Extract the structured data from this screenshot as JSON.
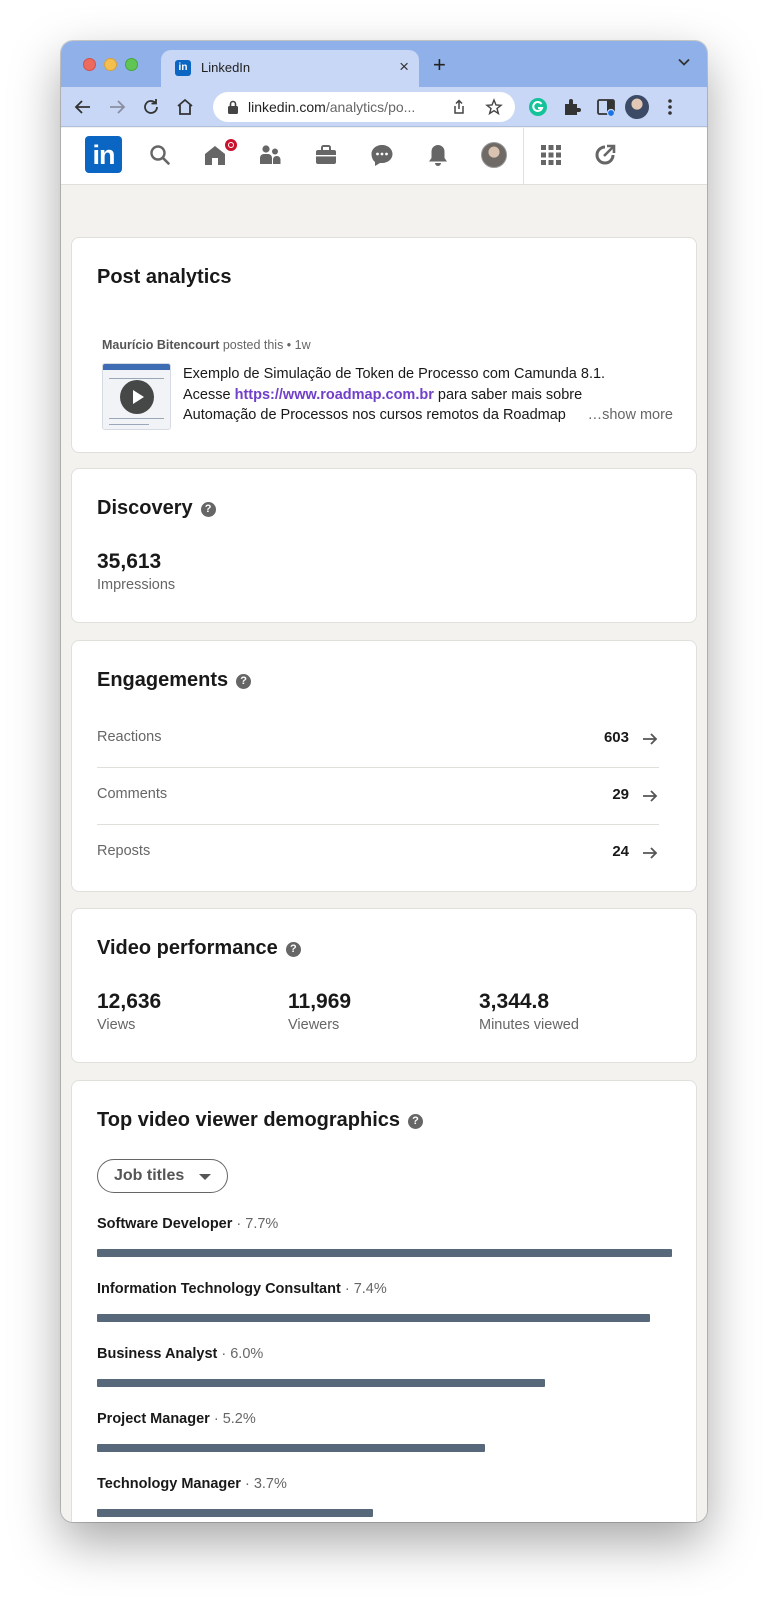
{
  "browser": {
    "tab_title": "LinkedIn",
    "tab_favicon": "in",
    "new_tab_label": "+",
    "tab_close_label": "×",
    "url_host": "linkedin.com",
    "url_path": "/analytics/po..."
  },
  "linkedin_nav": {
    "logo": "in",
    "icons": [
      "search-icon",
      "home-icon",
      "my-network-icon",
      "jobs-icon",
      "messaging-icon",
      "notifications-icon",
      "me-avatar",
      "apps-grid-icon",
      "advertise-icon"
    ],
    "home_badge_color": "#cb112d"
  },
  "post_card": {
    "title": "Post analytics",
    "author": "Maurício Bitencourt",
    "posted_suffix": "posted this • 1w",
    "text_line1": "Exemplo de Simulação de Token de Processo com Camunda 8.1.",
    "text_line2_prefix": "Acesse ",
    "text_line2_link": "https://www.roadmap.com.br",
    "text_line2_suffix": " para saber mais sobre",
    "text_line3": "Automação de Processos nos cursos remotos da Roadmap",
    "show_more": "…show more"
  },
  "discovery": {
    "title": "Discovery",
    "impressions_value": "35,613",
    "impressions_label": "Impressions"
  },
  "engagements": {
    "title": "Engagements",
    "rows": [
      {
        "label": "Reactions",
        "value": "603"
      },
      {
        "label": "Comments",
        "value": "29"
      },
      {
        "label": "Reposts",
        "value": "24"
      }
    ]
  },
  "video_performance": {
    "title": "Video performance",
    "metrics": [
      {
        "value": "12,636",
        "label": "Views"
      },
      {
        "value": "11,969",
        "label": "Viewers"
      },
      {
        "value": "3,344.8",
        "label": "Minutes viewed"
      }
    ]
  },
  "demographics": {
    "title": "Top video viewer demographics",
    "dropdown_label": "Job titles",
    "bar_color": "#56687a",
    "rows": [
      {
        "name": "Software Developer",
        "pct": " · 7.7%",
        "value": 7.7
      },
      {
        "name": "Information Technology Consultant",
        "pct": " · 7.4%",
        "value": 7.4
      },
      {
        "name": "Business Analyst",
        "pct": " · 6.0%",
        "value": 6.0
      },
      {
        "name": "Project Manager",
        "pct": " · 5.2%",
        "value": 5.2
      },
      {
        "name": "Technology Manager",
        "pct": " · 3.7%",
        "value": 3.7
      }
    ]
  },
  "colors": {
    "linkedin_blue": "#0a66c2",
    "link_purple": "#7140c8",
    "page_bg": "#f4f2ee"
  }
}
